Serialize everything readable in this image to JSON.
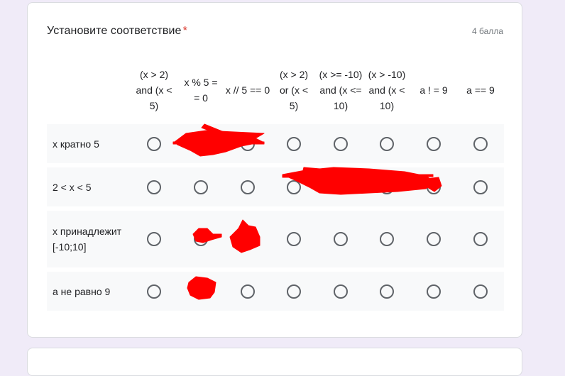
{
  "question": {
    "title": "Установите соответствие",
    "required_mark": "*",
    "points": "4 балла"
  },
  "columns": [
    {
      "label": "(x > 2) and (x < 5)"
    },
    {
      "label": "x % 5 = = 0"
    },
    {
      "label": "x // 5 == 0"
    },
    {
      "label": "(x > 2) or (x < 5)"
    },
    {
      "label": "(x >= -10) and (x <= 10)"
    },
    {
      "label": "(x > -10) and (x < 10)"
    },
    {
      "label": "a ! = 9"
    },
    {
      "label": "a == 9"
    }
  ],
  "rows": [
    {
      "label": "х кратно 5"
    },
    {
      "label": "2 < x < 5"
    },
    {
      "label": "х принадлежит [-10;10]"
    },
    {
      "label": "а не равно 9"
    }
  ],
  "colors": {
    "background": "#f0ebf8",
    "required": "#d93025",
    "scribble": "#ff0000"
  }
}
